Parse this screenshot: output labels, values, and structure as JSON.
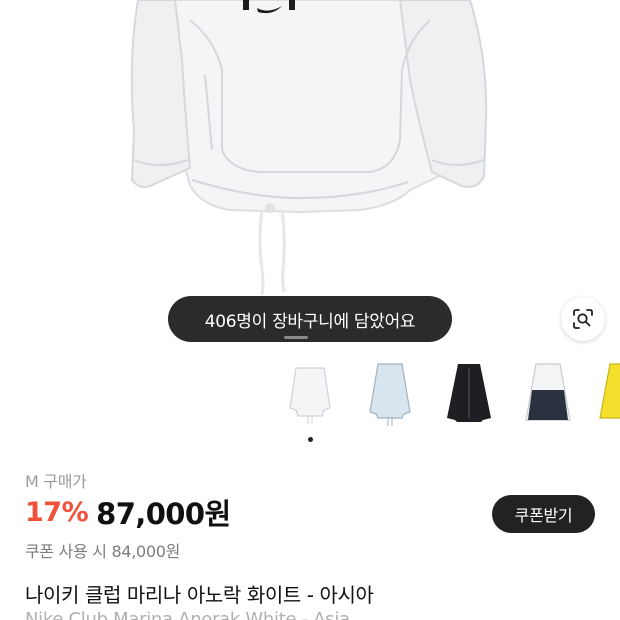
{
  "banner": {
    "cart_count_message": "406명이 장바구니에 담았어요"
  },
  "lens_button": {
    "icon": "image-search-icon"
  },
  "thumbnails": [
    {
      "label": "white-anorak",
      "color": "#f1f2f4"
    },
    {
      "label": "light-blue-anorak",
      "color": "#cfdde8"
    },
    {
      "label": "black-jacket",
      "color": "#1d1f22"
    },
    {
      "label": "white-navy-jacket",
      "color": "#2a3240"
    },
    {
      "label": "yellow-jacket",
      "color": "#f3df2c"
    }
  ],
  "product": {
    "size_label": "M 구매가",
    "discount": "17%",
    "price": "87,000원",
    "coupon_button": "쿠폰받기",
    "coupon_price": "쿠폰 사용 시 84,000원",
    "name_ko": "나이키 클럽 마리나 아노락 화이트 - 아시아",
    "name_en": "Nike Club Marina Anorak White - Asia"
  }
}
